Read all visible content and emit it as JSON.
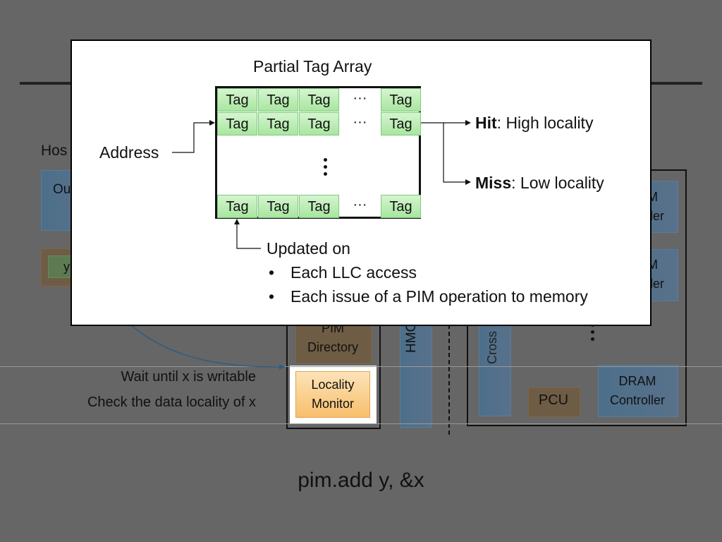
{
  "background_slide": {
    "host_label": "Hos",
    "core_label": "Ou",
    "register_label": "y",
    "pim_directory_label": [
      "PIM",
      "Directory"
    ],
    "locality_monitor_label": [
      "Locality",
      "Monitor"
    ],
    "hmc_label": "HMC",
    "crossbar_label": "Cross",
    "dram_controllers": [
      {
        "label": [
          "M",
          "ller"
        ]
      },
      {
        "label": [
          "M",
          "ller"
        ]
      },
      {
        "label": [
          "DRAM",
          "Controller"
        ]
      }
    ],
    "pcu_label": "PCU",
    "steps": [
      "Wait until x is writable",
      "Check the data locality of x"
    ],
    "instruction": "pim.add y, &x"
  },
  "popup": {
    "title": "Partial Tag Array",
    "address_label": "Address",
    "tag_rows": [
      [
        "Tag",
        "Tag",
        "Tag",
        "···",
        "Tag"
      ],
      [
        "Tag",
        "Tag",
        "Tag",
        "···",
        "Tag"
      ],
      [
        "Tag",
        "Tag",
        "Tag",
        "···",
        "Tag"
      ]
    ],
    "hit": {
      "term": "Hit",
      "desc": ": High locality"
    },
    "miss": {
      "term": "Miss",
      "desc": ": Low locality"
    },
    "updated_on": "Updated on",
    "bullets": [
      "Each LLC access",
      "Each issue of a PIM operation to memory"
    ]
  },
  "colors": {
    "background": "#666666",
    "tag_green": "#a8e6a0",
    "locality_orange": "#f7bf6c",
    "blue_block": "#58718a",
    "brown_block": "#6e5c44"
  }
}
